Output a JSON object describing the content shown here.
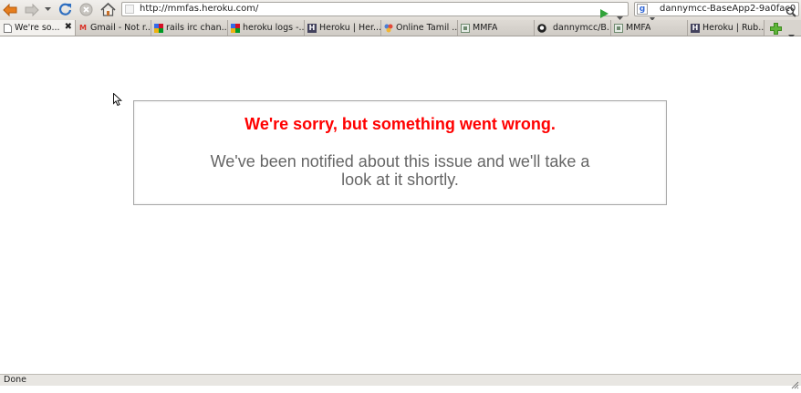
{
  "browser": {
    "url": "http://mmfas.heroku.com/",
    "search_query": "dannymcc-BaseApp2-9a0fac0",
    "search_engine_icon": "google-icon",
    "status": "Done"
  },
  "toolbar": {
    "buttons": [
      "back-icon",
      "forward-icon",
      "history-dropdown-icon",
      "reload-icon",
      "stop-icon",
      "home-icon"
    ]
  },
  "tabs": [
    {
      "label": "We're so...",
      "icon": "page-icon",
      "active": true
    },
    {
      "label": "Gmail - Not r...",
      "icon": "gmail-icon",
      "active": false
    },
    {
      "label": "rails irc chan...",
      "icon": "google-icon",
      "active": false
    },
    {
      "label": "heroku logs -...",
      "icon": "google-icon",
      "active": false
    },
    {
      "label": "Heroku | Her...",
      "icon": "heroku-icon",
      "active": false
    },
    {
      "label": "Online Tamil ...",
      "icon": "site-icon",
      "active": false
    },
    {
      "label": "MMFA",
      "icon": "page-icon",
      "active": false
    },
    {
      "label": "dannymcc/B...",
      "icon": "github-icon",
      "active": false
    },
    {
      "label": "MMFA",
      "icon": "page-icon",
      "active": false
    },
    {
      "label": "Heroku | Rub...",
      "icon": "heroku-icon",
      "active": false
    }
  ],
  "page": {
    "error_title": "We're sorry, but something went wrong.",
    "error_message": "We've been notified about this issue and we'll take a look at it shortly."
  },
  "colors": {
    "error_title": "#ff0000",
    "error_message": "#666666",
    "box_border": "#a8a8a8"
  }
}
